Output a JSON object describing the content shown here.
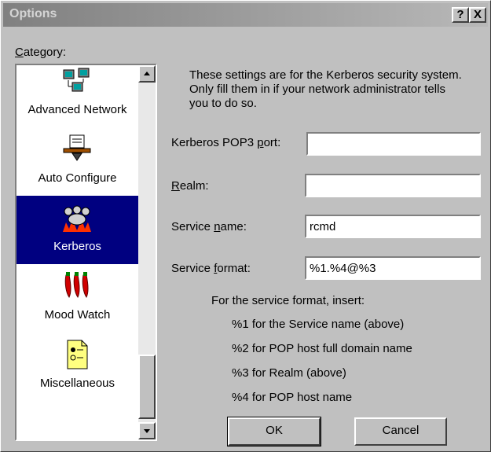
{
  "window": {
    "title": "Options",
    "help_button": "?",
    "close_button": "X"
  },
  "category": {
    "label_pre": "",
    "label_u": "C",
    "label_post": "ategory:",
    "items": [
      {
        "label": "Advanced Network",
        "icon": "network-computers-icon",
        "selected": false
      },
      {
        "label": "Auto Configure",
        "icon": "auto-configure-icon",
        "selected": false
      },
      {
        "label": "Kerberos",
        "icon": "kerberos-dog-icon",
        "selected": true
      },
      {
        "label": "Mood Watch",
        "icon": "chili-peppers-icon",
        "selected": false
      },
      {
        "label": "Miscellaneous",
        "icon": "misc-document-icon",
        "selected": false
      }
    ]
  },
  "kerberos": {
    "description": "These settings are for the Kerberos security system. Only fill them in if your network administrator tells you to do so.",
    "pop3_port_pre": "Kerberos POP3 ",
    "pop3_port_u": "p",
    "pop3_port_post": "ort:",
    "pop3_port_value": "",
    "realm_pre": "",
    "realm_u": "R",
    "realm_post": "ealm:",
    "realm_value": "",
    "service_name_pre": "Service ",
    "service_name_u": "n",
    "service_name_post": "ame:",
    "service_name_value": "rcmd",
    "service_format_pre": "Service ",
    "service_format_u": "f",
    "service_format_post": "ormat:",
    "service_format_value": "%1.%4@%3",
    "format_heading": "For the service format, insert:",
    "format_hints": [
      "%1 for the Service name (above)",
      "%2 for POP host full domain name",
      "%3 for Realm (above)",
      "%4 for POP host name"
    ]
  },
  "buttons": {
    "ok": "OK",
    "cancel": "Cancel"
  },
  "colors": {
    "selection": "#000080",
    "face": "#c0c0c0"
  }
}
